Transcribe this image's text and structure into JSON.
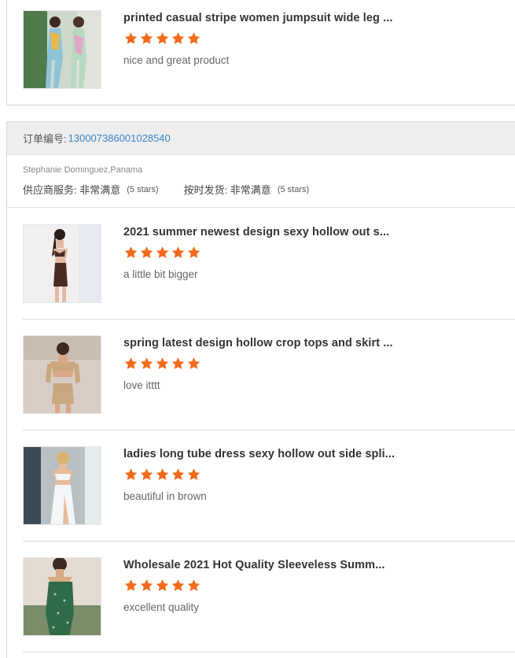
{
  "top_item": {
    "title": "printed casual stripe women jumpsuit wide leg ...",
    "rating": 5,
    "comment": "nice and great product"
  },
  "order": {
    "label": "订单编号:",
    "number": "130007386001028540",
    "buyer": "Stephanie Dominguez,Panama",
    "supplier_service_label": "供应商服务: 非常满意",
    "supplier_service_stars": "(5 stars)",
    "shipping_label": "按时发货: 非常满意",
    "shipping_stars": "(5 stars)",
    "items": [
      {
        "title": "2021 summer newest design sexy hollow out s...",
        "rating": 5,
        "comment": "a little bit bigger"
      },
      {
        "title": "spring latest design hollow crop tops and skirt ...",
        "rating": 5,
        "comment": "love itttt"
      },
      {
        "title": "ladies long tube dress sexy hollow out side spli...",
        "rating": 5,
        "comment": "beautiful in brown"
      },
      {
        "title": "Wholesale 2021 Hot Quality Sleeveless Summ...",
        "rating": 5,
        "comment": "excellent quality"
      }
    ]
  },
  "colors": {
    "star": "#f26a1b",
    "link": "#3a86c8"
  },
  "icons": {
    "star": "star-icon",
    "thumbnail": "product-photo"
  }
}
